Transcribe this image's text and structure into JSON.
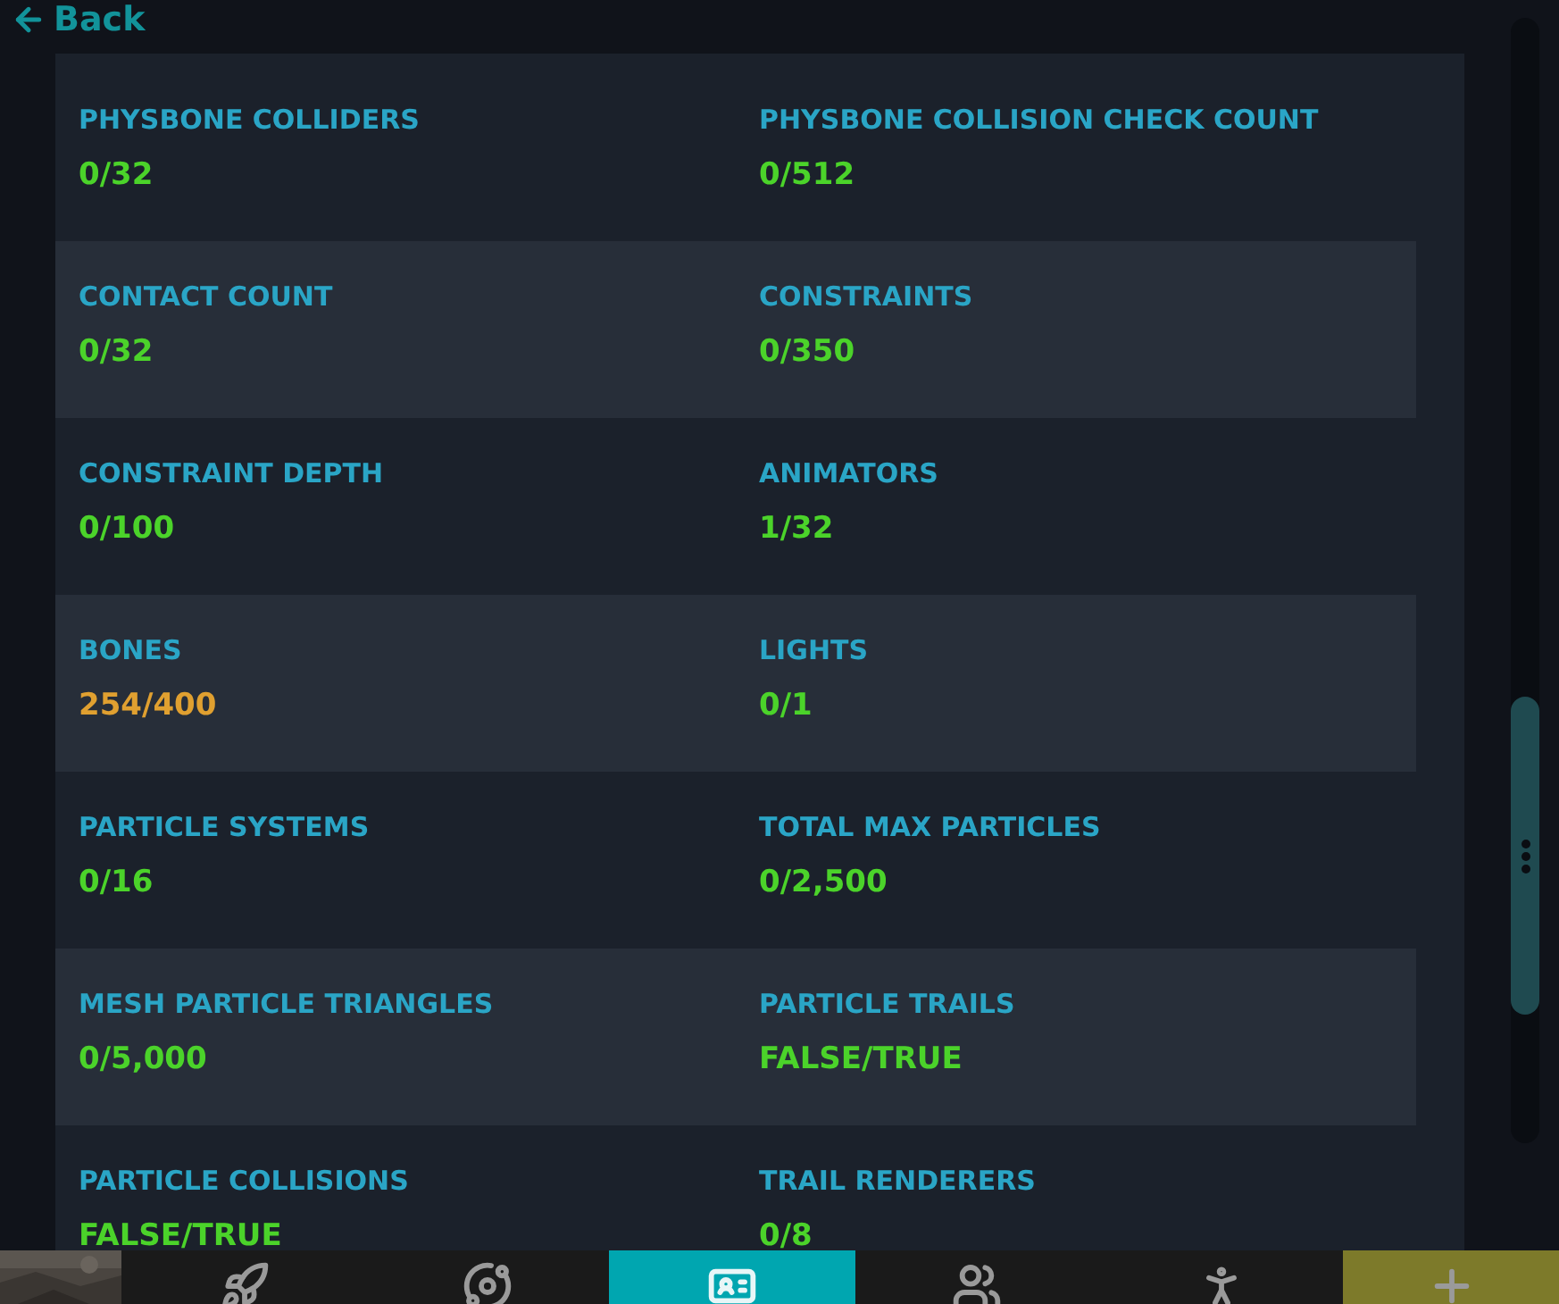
{
  "back": {
    "label": "Back"
  },
  "stats": [
    {
      "cells": [
        {
          "label": "PHYSBONE COLLIDERS",
          "value": "0/32",
          "color": "#4bd32a"
        },
        {
          "label": "PHYSBONE COLLISION CHECK COUNT",
          "value": "0/512",
          "color": "#4bd32a"
        }
      ]
    },
    {
      "cells": [
        {
          "label": "CONTACT COUNT",
          "value": "0/32",
          "color": "#4bd32a"
        },
        {
          "label": "CONSTRAINTS",
          "value": "0/350",
          "color": "#4bd32a"
        }
      ]
    },
    {
      "cells": [
        {
          "label": "CONSTRAINT DEPTH",
          "value": "0/100",
          "color": "#4bd32a"
        },
        {
          "label": "ANIMATORS",
          "value": "1/32",
          "color": "#4bd32a"
        }
      ]
    },
    {
      "cells": [
        {
          "label": "BONES",
          "value": "254/400",
          "color": "#e0a030"
        },
        {
          "label": "LIGHTS",
          "value": "0/1",
          "color": "#4bd32a"
        }
      ]
    },
    {
      "cells": [
        {
          "label": "PARTICLE SYSTEMS",
          "value": "0/16",
          "color": "#4bd32a"
        },
        {
          "label": "TOTAL MAX PARTICLES",
          "value": "0/2,500",
          "color": "#4bd32a"
        }
      ]
    },
    {
      "cells": [
        {
          "label": "MESH PARTICLE TRIANGLES",
          "value": "0/5,000",
          "color": "#4bd32a"
        },
        {
          "label": "PARTICLE TRAILS",
          "value": "FALSE/TRUE",
          "color": "#4bd32a"
        }
      ]
    },
    {
      "cells": [
        {
          "label": "PARTICLE COLLISIONS",
          "value": "FALSE/TRUE",
          "color": "#4bd32a"
        },
        {
          "label": "TRAIL RENDERERS",
          "value": "0/8",
          "color": "#4bd32a"
        }
      ]
    }
  ],
  "bottom_bar": {
    "tabs": [
      {
        "kind": "rocket",
        "selected": false
      },
      {
        "kind": "planet",
        "selected": false
      },
      {
        "kind": "card",
        "selected": true
      },
      {
        "kind": "people",
        "selected": false
      },
      {
        "kind": "avatar",
        "selected": false
      },
      {
        "kind": "plus",
        "selected": false
      }
    ]
  }
}
